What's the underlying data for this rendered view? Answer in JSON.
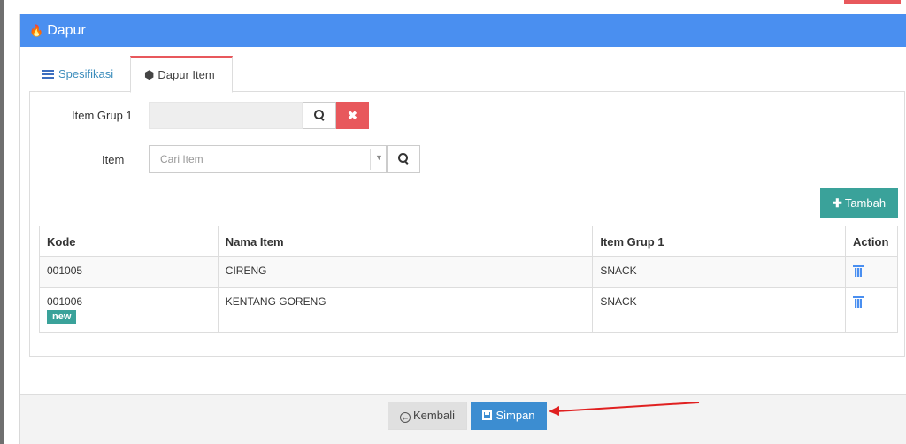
{
  "panel": {
    "title": "Dapur",
    "header_color": "#4a8ff0"
  },
  "tabs": [
    {
      "label": "Spesifikasi",
      "icon": "list-icon",
      "active": false
    },
    {
      "label": "Dapur Item",
      "icon": "cube-icon",
      "active": true
    }
  ],
  "form": {
    "item_grup_label": "Item Grup 1",
    "item_grup_value": "",
    "item_label": "Item",
    "item_placeholder": "Cari Item",
    "clear_symbol": "✖"
  },
  "actions": {
    "tambah_label": "Tambah"
  },
  "table": {
    "columns": [
      "Kode",
      "Nama Item",
      "Item Grup 1",
      "Action"
    ],
    "rows": [
      {
        "kode": "001005",
        "nama": "CIRENG",
        "grup": "SNACK",
        "badge": ""
      },
      {
        "kode": "001006",
        "nama": "KENTANG GORENG",
        "grup": "SNACK",
        "badge": "new"
      }
    ]
  },
  "footer": {
    "kembali_label": "Kembali",
    "simpan_label": "Simpan"
  },
  "colors": {
    "accent": "#4a8ff0",
    "danger": "#e8585c",
    "success": "#3aa29a",
    "primary_button": "#3c8dd1",
    "annotation_arrow": "#e02020"
  }
}
